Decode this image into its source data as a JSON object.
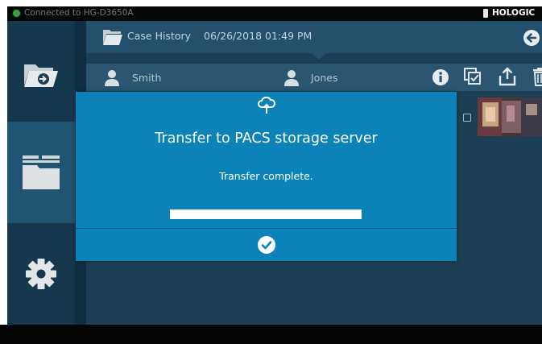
{
  "status_bar": {
    "connection_text": "Connected to HG-D3650A",
    "brand": "HOLOGIC",
    "connection_color": "#3a9e3f"
  },
  "sidebar": {
    "items": [
      {
        "name": "import-folder",
        "icon": "folder-import-icon",
        "selected": false
      },
      {
        "name": "case-files",
        "icon": "folder-stack-icon",
        "selected": true
      },
      {
        "name": "settings",
        "icon": "gear-icon",
        "selected": false
      }
    ]
  },
  "header": {
    "title": "Case History",
    "datetime": "06/26/2018 01:49 PM",
    "back_icon": "back-arrow-icon"
  },
  "patient_row": {
    "patient_1": "Smith",
    "patient_2": "Jones",
    "actions": [
      "info-icon",
      "select-icon",
      "share-icon",
      "trash-icon"
    ]
  },
  "dialog": {
    "icon": "cloud-upload-icon",
    "title": "Transfer to PACS storage server",
    "message": "Transfer complete.",
    "progress": 1.0,
    "confirm_icon": "check-circle-icon"
  },
  "colors": {
    "dialog_bg": "#0b82b8",
    "app_bg": "#1d3f56",
    "sidebar_selected": "#1f5472"
  }
}
